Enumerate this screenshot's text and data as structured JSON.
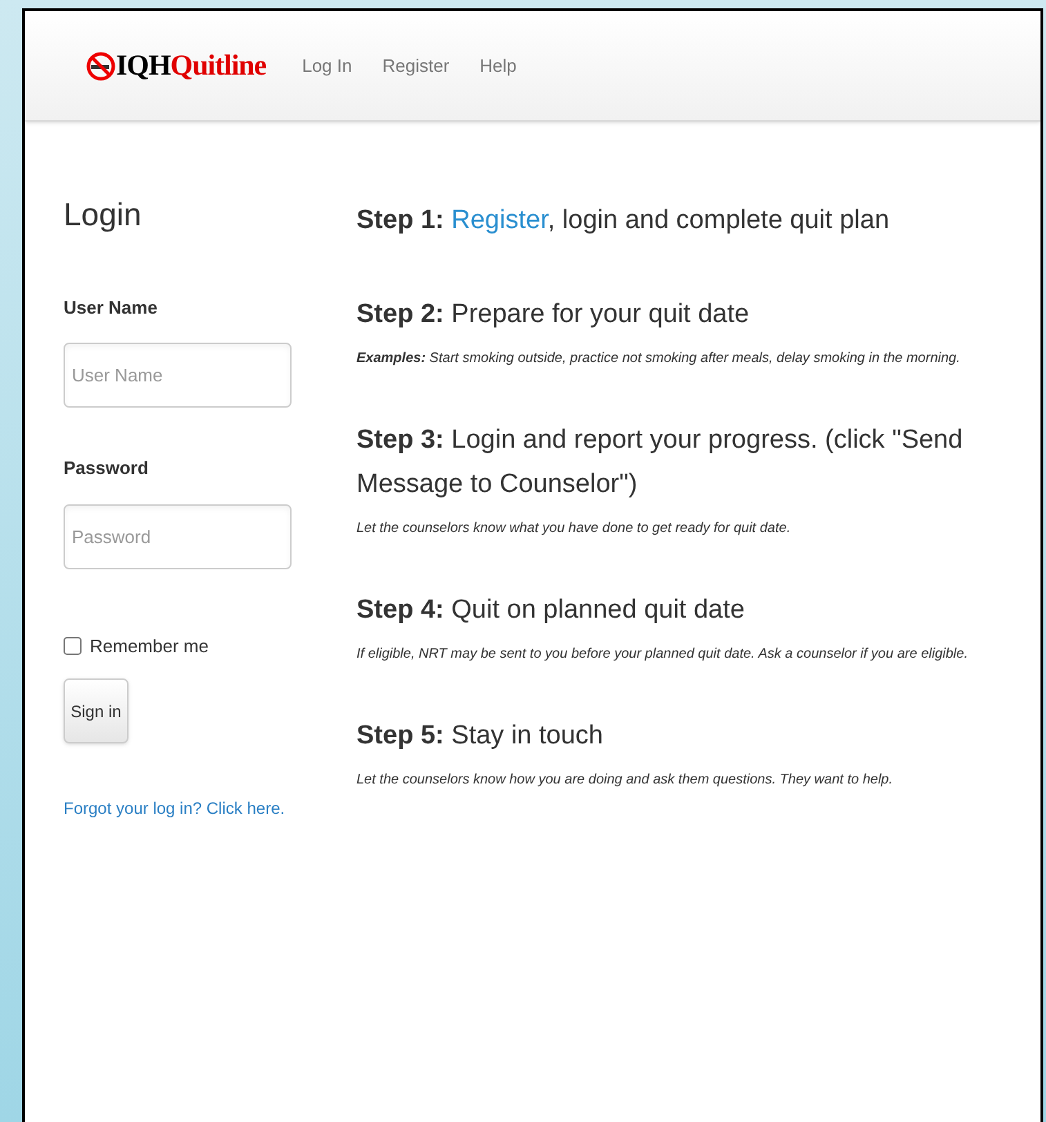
{
  "navbar": {
    "logo": {
      "part1": "IQH",
      "part2": "Quitline"
    },
    "links": [
      "Log In",
      "Register",
      "Help"
    ]
  },
  "login": {
    "title": "Login",
    "fields": [
      {
        "label": "User Name",
        "placeholder": "User Name"
      },
      {
        "label": "Password",
        "placeholder": "Password"
      }
    ],
    "remember": {
      "label": "Remember me",
      "checked": false
    },
    "button": "Sign in",
    "forgot_link": "Forgot your log in? Click here."
  },
  "steps": [
    {
      "heading": [
        {
          "kind": "bold",
          "text": "Step 1:"
        },
        {
          "kind": "link",
          "text": "Register"
        },
        {
          "kind": "text",
          "text": ", login and complete quit plan"
        }
      ]
    },
    {
      "heading": [
        {
          "kind": "bold",
          "text": "Step 2:"
        },
        {
          "kind": "text",
          "text": "Prepare for your quit date"
        }
      ],
      "note": "**Examples:** Start smoking outside, practice not smoking after meals, delay smoking in the morning."
    },
    {
      "heading": [
        {
          "kind": "bold",
          "text": "Step 3:"
        },
        {
          "kind": "text",
          "text": "Login and report your progress. (click \"Send Message to Counselor\")"
        }
      ],
      "note": "Let the counselors know what you have done to get ready for quit date."
    },
    {
      "heading": [
        {
          "kind": "bold",
          "text": "Step 4:"
        },
        {
          "kind": "text",
          "text": "Quit on planned quit date"
        }
      ],
      "note": "If eligible, NRT may be sent to you before your planned quit date. Ask a counselor if you are eligible."
    },
    {
      "heading": [
        {
          "kind": "bold",
          "text": "Step 5:"
        },
        {
          "kind": "text",
          "text": "Stay in touch"
        }
      ],
      "note": "Let the counselors know how you are doing and ask them questions. They want to help."
    }
  ]
}
